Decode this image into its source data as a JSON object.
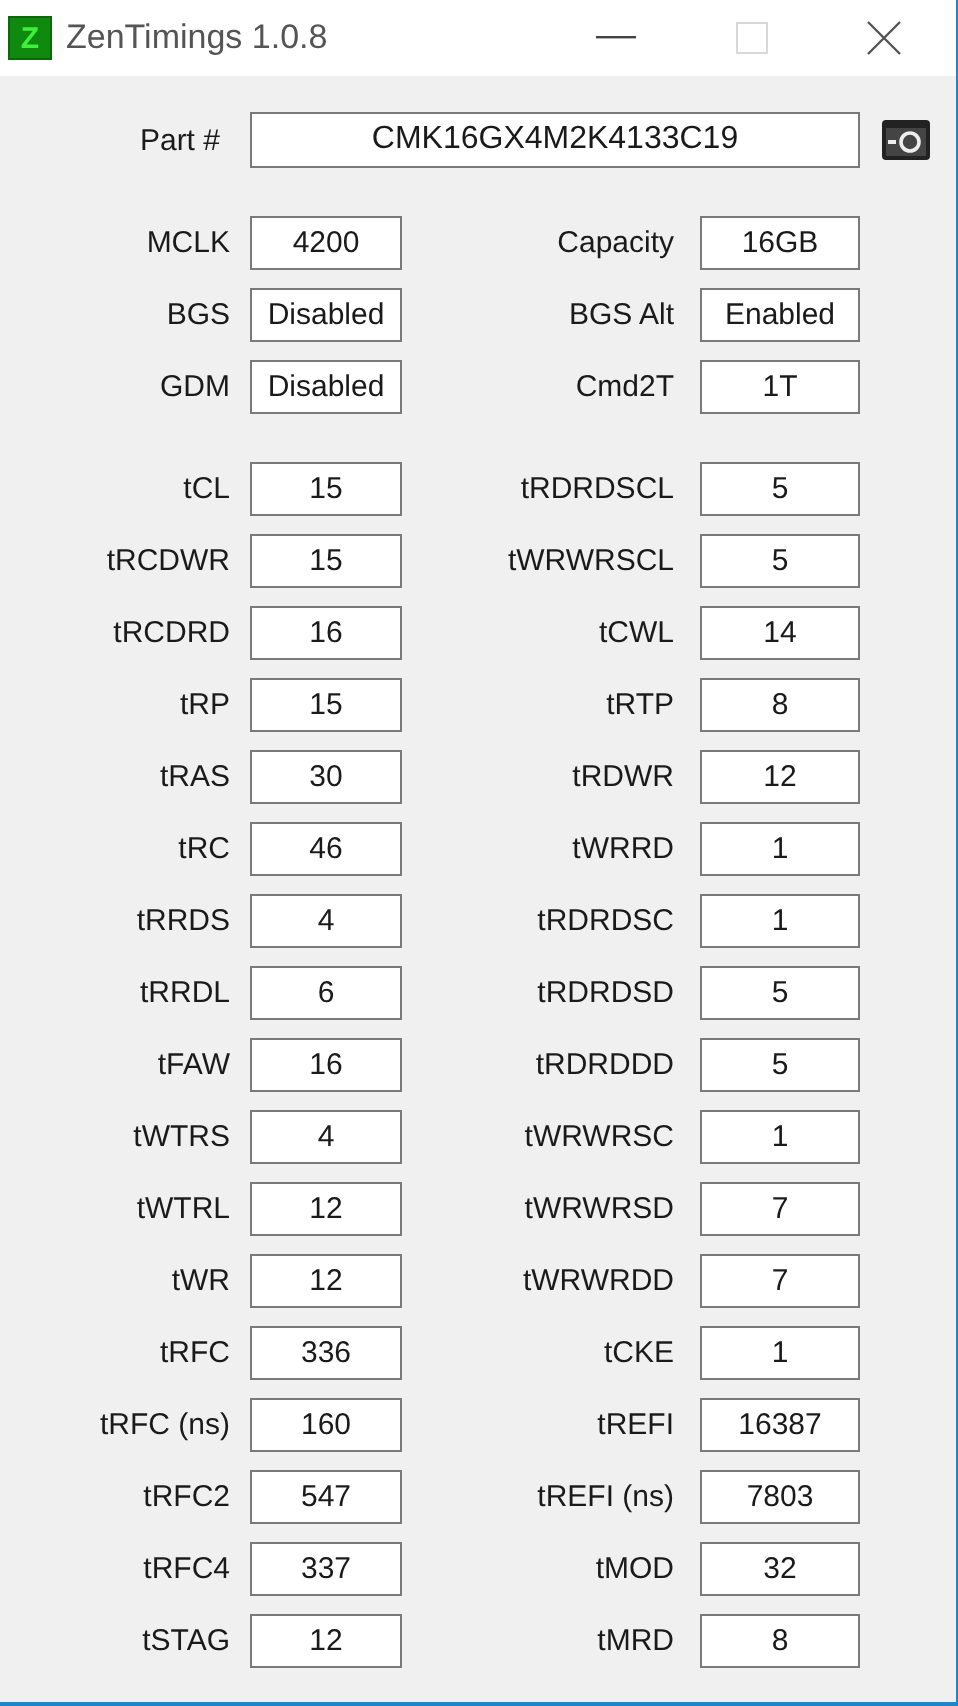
{
  "window": {
    "title": "ZenTimings 1.0.8",
    "icon_letter": "Z",
    "maximize_disabled": true
  },
  "part": {
    "label": "Part #",
    "value": "CMK16GX4M2K4133C19"
  },
  "sections": [
    [
      {
        "left": {
          "label": "MCLK",
          "value": "4200"
        },
        "right": {
          "label": "Capacity",
          "value": "16GB"
        }
      },
      {
        "left": {
          "label": "BGS",
          "value": "Disabled"
        },
        "right": {
          "label": "BGS Alt",
          "value": "Enabled"
        }
      },
      {
        "left": {
          "label": "GDM",
          "value": "Disabled"
        },
        "right": {
          "label": "Cmd2T",
          "value": "1T"
        }
      }
    ],
    [
      {
        "left": {
          "label": "tCL",
          "value": "15"
        },
        "right": {
          "label": "tRDRDSCL",
          "value": "5"
        }
      },
      {
        "left": {
          "label": "tRCDWR",
          "value": "15"
        },
        "right": {
          "label": "tWRWRSCL",
          "value": "5"
        }
      },
      {
        "left": {
          "label": "tRCDRD",
          "value": "16"
        },
        "right": {
          "label": "tCWL",
          "value": "14"
        }
      },
      {
        "left": {
          "label": "tRP",
          "value": "15"
        },
        "right": {
          "label": "tRTP",
          "value": "8"
        }
      },
      {
        "left": {
          "label": "tRAS",
          "value": "30"
        },
        "right": {
          "label": "tRDWR",
          "value": "12"
        }
      },
      {
        "left": {
          "label": "tRC",
          "value": "46"
        },
        "right": {
          "label": "tWRRD",
          "value": "1"
        }
      },
      {
        "left": {
          "label": "tRRDS",
          "value": "4"
        },
        "right": {
          "label": "tRDRDSC",
          "value": "1"
        }
      },
      {
        "left": {
          "label": "tRRDL",
          "value": "6"
        },
        "right": {
          "label": "tRDRDSD",
          "value": "5"
        }
      },
      {
        "left": {
          "label": "tFAW",
          "value": "16"
        },
        "right": {
          "label": "tRDRDDD",
          "value": "5"
        }
      },
      {
        "left": {
          "label": "tWTRS",
          "value": "4"
        },
        "right": {
          "label": "tWRWRSC",
          "value": "1"
        }
      },
      {
        "left": {
          "label": "tWTRL",
          "value": "12"
        },
        "right": {
          "label": "tWRWRSD",
          "value": "7"
        }
      },
      {
        "left": {
          "label": "tWR",
          "value": "12"
        },
        "right": {
          "label": "tWRWRDD",
          "value": "7"
        }
      },
      {
        "left": {
          "label": "tRFC",
          "value": "336"
        },
        "right": {
          "label": "tCKE",
          "value": "1"
        }
      },
      {
        "left": {
          "label": "tRFC (ns)",
          "value": "160"
        },
        "right": {
          "label": "tREFI",
          "value": "16387"
        }
      },
      {
        "left": {
          "label": "tRFC2",
          "value": "547"
        },
        "right": {
          "label": "tREFI (ns)",
          "value": "7803"
        }
      },
      {
        "left": {
          "label": "tRFC4",
          "value": "337"
        },
        "right": {
          "label": "tMOD",
          "value": "32"
        }
      },
      {
        "left": {
          "label": "tSTAG",
          "value": "12"
        },
        "right": {
          "label": "tMRD",
          "value": "8"
        }
      }
    ]
  ]
}
